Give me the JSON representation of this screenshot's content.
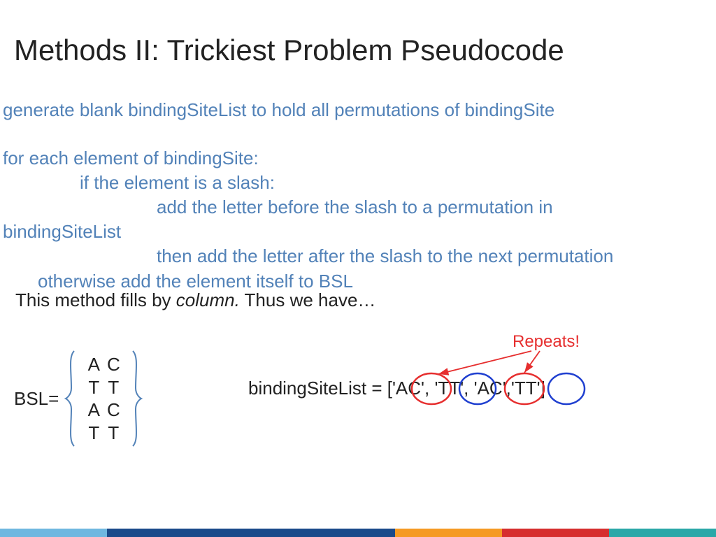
{
  "title": "Methods II: Trickiest Problem Pseudocode",
  "pseudo": {
    "a": "generate blank bindingSiteList to hold all permutations of bindingSite",
    "b": "for each element of bindingSite:",
    "c": "if the element is a slash:",
    "d": "add the letter before the slash to a permutation in",
    "e": "bindingSiteList",
    "f": "then add the letter after the slash to the next permutation",
    "g": "otherwise add the element itself to BSL"
  },
  "note_pre": "This method fills by ",
  "note_em": "column.",
  "note_post": " Thus we have…",
  "bsl_label": "BSL=",
  "matrix": {
    "r1": {
      "a": "A",
      "b": "C"
    },
    "r2": {
      "a": "T",
      "b": "T"
    },
    "r3": {
      "a": "A",
      "b": "C"
    },
    "r4": {
      "a": "T",
      "b": "T"
    }
  },
  "list_prefix": "bindingSiteList = [",
  "items": {
    "i1": "'AC'",
    "i2": "'TT'",
    "i3": "'AC'",
    "i4": "'TT'"
  },
  "sep": ", ",
  "sep2": ",",
  "list_suffix": "]",
  "repeats": "Repeats!",
  "colors": {
    "red": "#e62e2e",
    "blue": "#2040d0"
  }
}
